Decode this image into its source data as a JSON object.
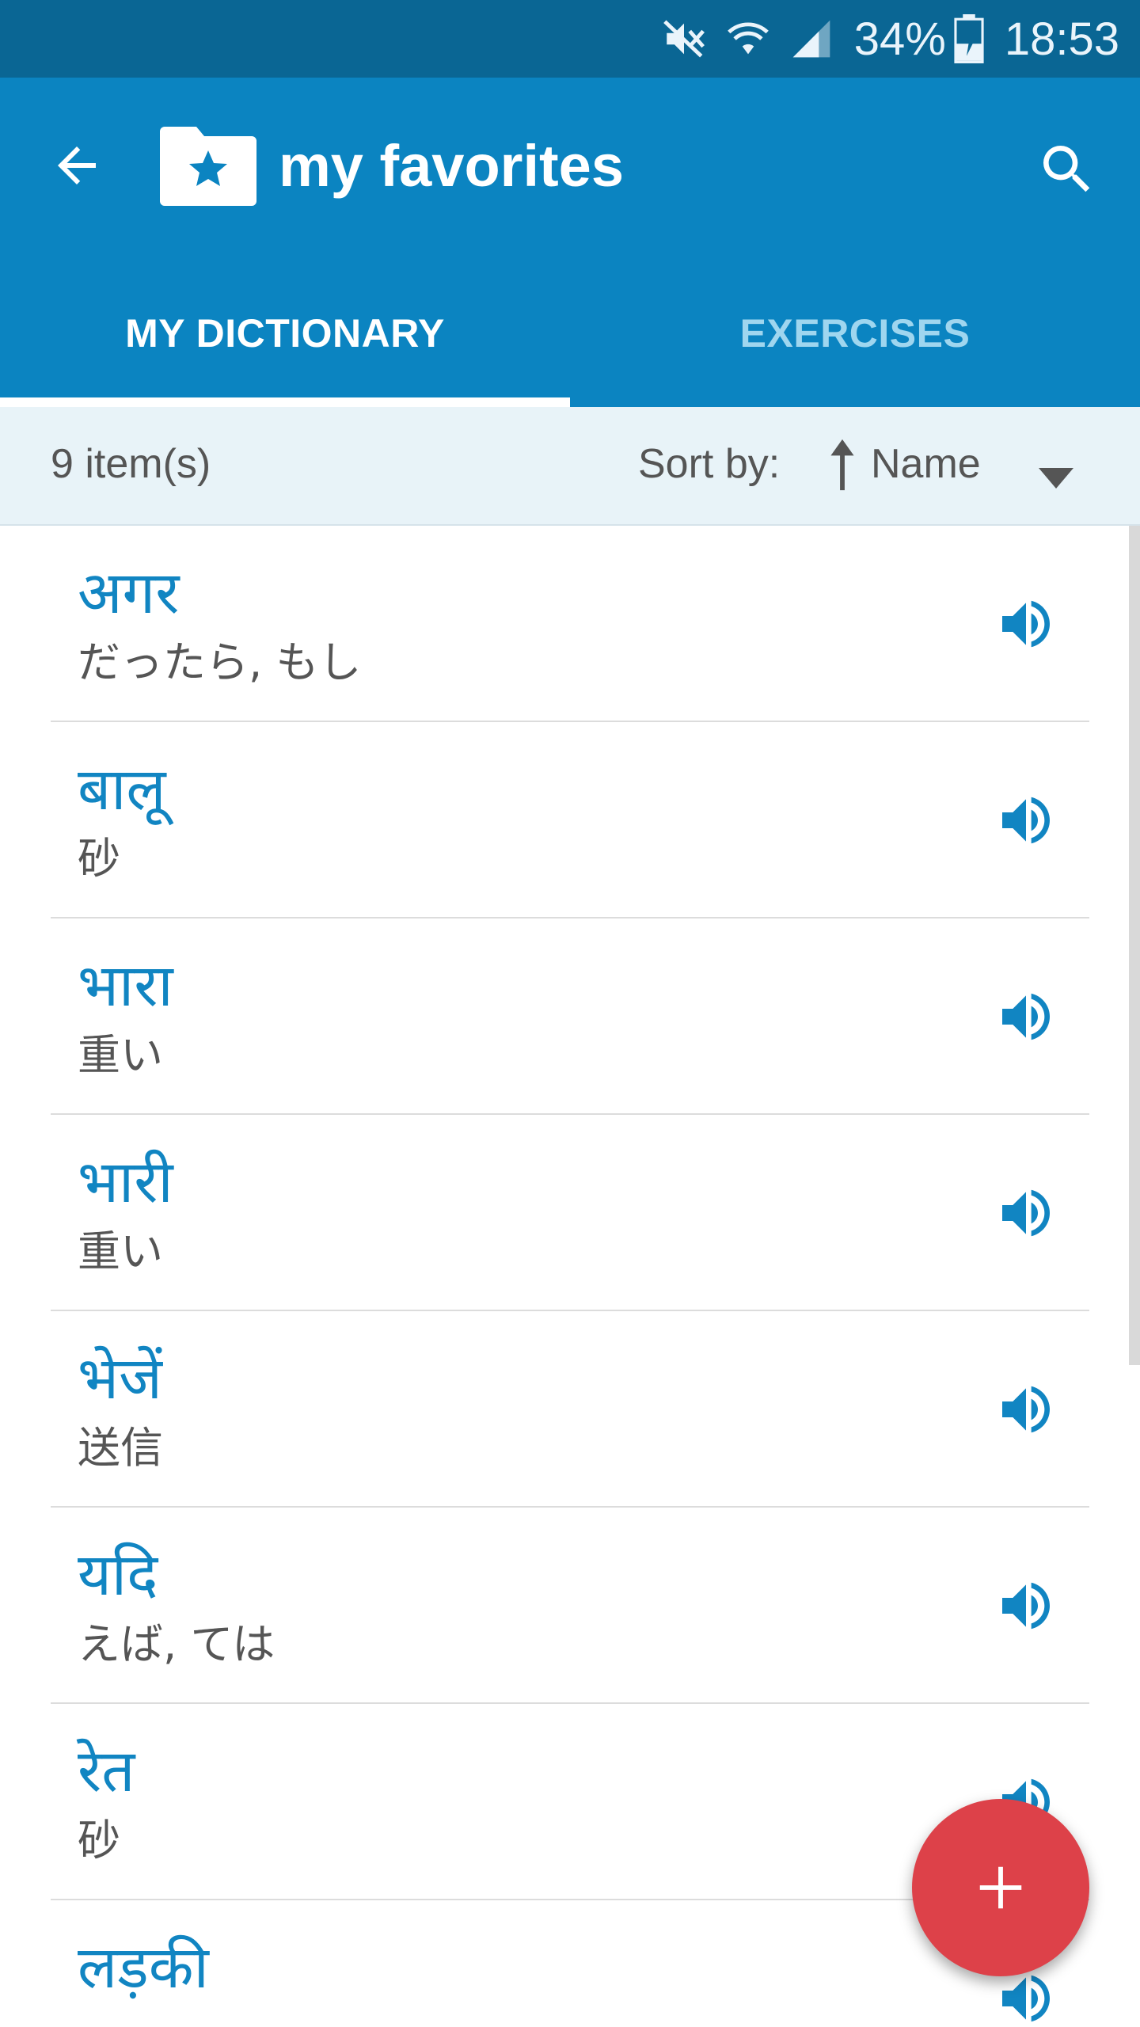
{
  "status_bar": {
    "battery": "34%",
    "time": "18:53",
    "icons": [
      "mute-icon",
      "wifi-icon",
      "signal-icon",
      "battery-charging-icon"
    ]
  },
  "app_bar": {
    "title": "my favorites",
    "back_icon": "arrow-left-icon",
    "folder_icon": "folder-star-icon",
    "search_icon": "search-icon"
  },
  "tabs": [
    {
      "label": "MY DICTIONARY",
      "active": true
    },
    {
      "label": "EXERCISES",
      "active": false
    }
  ],
  "summary": {
    "count": "9 item(s)",
    "sort_label": "Sort by:",
    "sort_value": "Name"
  },
  "items": [
    {
      "word": "अगर",
      "translation": "だったら, もし"
    },
    {
      "word": "बालू",
      "translation": "砂"
    },
    {
      "word": "भारा",
      "translation": "重い"
    },
    {
      "word": "भारी",
      "translation": "重い"
    },
    {
      "word": "भेजें",
      "translation": "送信"
    },
    {
      "word": "यदि",
      "translation": "えば, ては"
    },
    {
      "word": "रेत",
      "translation": "砂"
    },
    {
      "word": "लड़की",
      "translation": ""
    }
  ],
  "fab": {
    "icon": "plus-icon"
  },
  "colors": {
    "status_bar": "#0a6694",
    "app_bar": "#0b84c1",
    "accent": "#1185c2",
    "fab": "#dd4149"
  }
}
